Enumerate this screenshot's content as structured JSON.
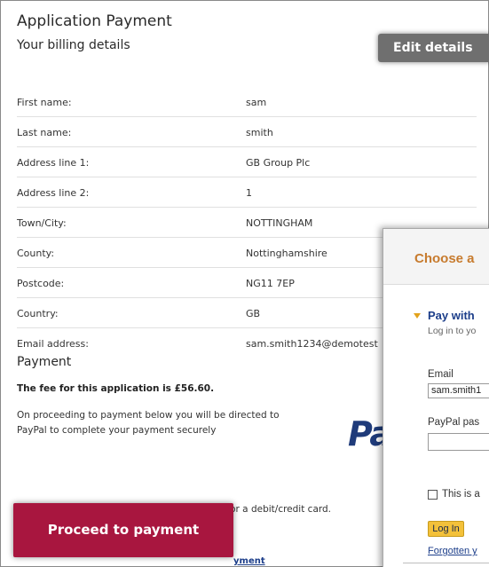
{
  "application": {
    "title": "Application Payment",
    "subtitle": "Your billing details",
    "edit_button": "Edit details"
  },
  "billing_details": [
    {
      "label": "First name:",
      "value": "sam"
    },
    {
      "label": "Last name:",
      "value": "smith"
    },
    {
      "label": "Address line 1:",
      "value": "GB Group Plc"
    },
    {
      "label": "Address line 2:",
      "value": "1"
    },
    {
      "label": "Town/City:",
      "value": "NOTTINGHAM"
    },
    {
      "label": "County:",
      "value": "Nottinghamshire"
    },
    {
      "label": "Postcode:",
      "value": "NG11 7EP"
    },
    {
      "label": "Country:",
      "value": "GB"
    },
    {
      "label": "Email address:",
      "value": "sam.smith1234@demotest"
    }
  ],
  "payment": {
    "heading": "Payment",
    "fee_text": "The fee for this application is £56.60.",
    "redirect_text": "On proceeding to payment below you will be directed to PayPal to complete your payment securely",
    "paypal_logo_text": "Pa",
    "note_text": "Please note you can pay by a PayPal account or a debit/credit card.",
    "proceed_button": "Proceed to payment",
    "partial_link": "yment"
  },
  "paypal_panel": {
    "choose_text": "Choose a",
    "pay_with": "Pay with",
    "login_hint": "Log in to yo",
    "email_label": "Email",
    "email_value": "sam.smith1",
    "password_label": "PayPal pas",
    "checkbox_label": "This is a",
    "login_button": "Log In",
    "forgotten_link": "Forgotten y"
  },
  "colors": {
    "proceed_button": "#a8163f",
    "edit_button": "#6f6f6f",
    "paypal_blue": "#1c3e8a",
    "choose_orange": "#c77b2e",
    "login_button": "#f3c13a"
  }
}
